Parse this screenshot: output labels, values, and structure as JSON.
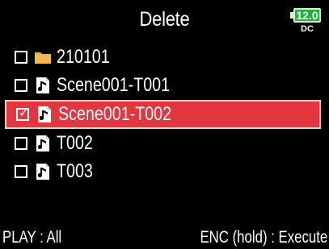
{
  "header": {
    "title": "Delete"
  },
  "battery": {
    "voltage": "12.0",
    "source": "DC",
    "color": "#22b33a"
  },
  "list": {
    "items": [
      {
        "name": "210101",
        "type": "folder",
        "icon": "folder-icon",
        "checked": false,
        "selected": false
      },
      {
        "name": "Scene001-T001",
        "type": "file",
        "icon": "audio-file-icon",
        "checked": false,
        "selected": false
      },
      {
        "name": "Scene001-T002",
        "type": "file",
        "icon": "audio-file-icon",
        "checked": true,
        "selected": true
      },
      {
        "name": "T002",
        "type": "file",
        "icon": "audio-file-icon",
        "checked": false,
        "selected": false
      },
      {
        "name": "T003",
        "type": "file",
        "icon": "audio-file-icon",
        "checked": false,
        "selected": false
      }
    ],
    "selection_color": "#e2373f",
    "folder_color": "#f2a93b"
  },
  "footer": {
    "left_label": "PLAY : All",
    "right_label": "ENC (hold) : Execute"
  }
}
